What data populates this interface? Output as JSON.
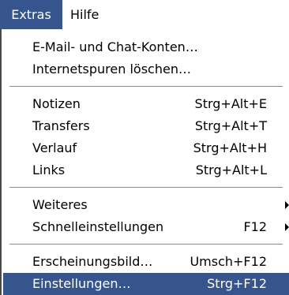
{
  "menubar": {
    "items": [
      {
        "label": "Extras"
      },
      {
        "label": "Hilfe"
      }
    ]
  },
  "menu": {
    "groups": [
      {
        "items": [
          {
            "label": "E-Mail- und Chat-Konten…",
            "shortcut": ""
          },
          {
            "label": "Internetspuren löschen…",
            "shortcut": ""
          }
        ]
      },
      {
        "items": [
          {
            "label": "Notizen",
            "shortcut": "Strg+Alt+E"
          },
          {
            "label": "Transfers",
            "shortcut": "Strg+Alt+T"
          },
          {
            "label": "Verlauf",
            "shortcut": "Strg+Alt+H"
          },
          {
            "label": "Links",
            "shortcut": "Strg+Alt+L"
          }
        ]
      },
      {
        "items": [
          {
            "label": "Weiteres",
            "shortcut": "",
            "submenu": true
          },
          {
            "label": "Schnelleinstellungen",
            "shortcut": "F12",
            "submenu": true
          }
        ]
      },
      {
        "items": [
          {
            "label": "Erscheinungsbild…",
            "shortcut": "Umsch+F12"
          },
          {
            "label": "Einstellungen…",
            "shortcut": "Strg+F12",
            "highlighted": true
          }
        ]
      }
    ]
  },
  "colors": {
    "highlight": "#36558f",
    "highlight_text": "#ffffff",
    "separator": "#8c8c8c"
  },
  "icons": {
    "submenu": "submenu-arrow-icon"
  }
}
